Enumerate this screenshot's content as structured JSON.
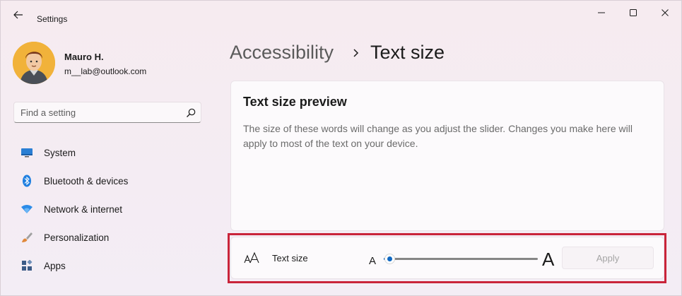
{
  "window": {
    "title": "Settings"
  },
  "profile": {
    "name": "Mauro H.",
    "email": "m__lab@outlook.com"
  },
  "search": {
    "placeholder": "Find a setting"
  },
  "sidebar": {
    "items": [
      {
        "label": "System",
        "icon": "monitor-icon",
        "color": "#2a7fd4"
      },
      {
        "label": "Bluetooth & devices",
        "icon": "bluetooth-icon",
        "color": "#1f7fe0"
      },
      {
        "label": "Network & internet",
        "icon": "wifi-icon",
        "color": "#2b8be8"
      },
      {
        "label": "Personalization",
        "icon": "brush-icon",
        "color": "#e0883a"
      },
      {
        "label": "Apps",
        "icon": "apps-icon",
        "color": "#3b5a86"
      }
    ]
  },
  "breadcrumb": {
    "parent": "Accessibility",
    "current": "Text size"
  },
  "preview": {
    "title": "Text size preview",
    "body": "The size of these words will change as you adjust the slider. Changes you make here will apply to most of the text on your device."
  },
  "text_size": {
    "label": "Text size",
    "small_glyph": "A",
    "large_glyph": "A",
    "slider_level": 0.0,
    "apply_label": "Apply",
    "apply_enabled": false
  },
  "colors": {
    "accent": "#1168c2",
    "highlight": "#c9243a"
  }
}
